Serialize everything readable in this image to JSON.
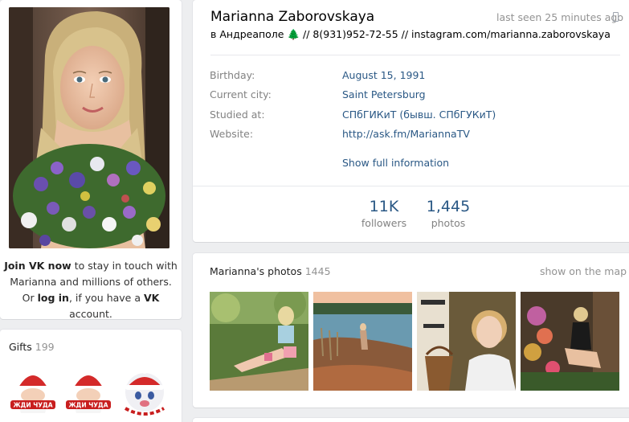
{
  "profile": {
    "name": "Marianna Zaborovskaya",
    "last_seen": "last seen 25 minutes ago",
    "status_prefix": "в Андреаполе",
    "status_tree": "🌲",
    "status_rest": " // 8(931)952-72-55 // instagram.com/marianna.zaborovskaya",
    "info": [
      {
        "label": "Birthday:",
        "value": "August 15, 1991"
      },
      {
        "label": "Current city:",
        "value": "Saint Petersburg"
      },
      {
        "label": "Studied at:",
        "value": "СПбГИКиТ (бывш. СПбГУКиТ)"
      },
      {
        "label": "Website:",
        "value": "http://ask.fm/MariannaTV"
      }
    ],
    "show_full": "Show full information",
    "counters": [
      {
        "num": "11K",
        "label": "followers"
      },
      {
        "num": "1,445",
        "label": "photos"
      }
    ]
  },
  "join": {
    "line1_bold": "Join VK now",
    "line1_rest": " to stay in touch with",
    "line2": "Marianna and millions of others.",
    "line3_a": "Or ",
    "line3_login": "log in",
    "line3_b": ", if you have a ",
    "line3_vk": "VK",
    "line3_c": " account."
  },
  "gifts": {
    "title": "Gifts",
    "count": "199",
    "items": [
      {
        "icon": "santa-gift-icon",
        "text": "ЖДИ ЧУДА"
      },
      {
        "icon": "santa-gift-icon",
        "text": "ЖДИ ЧУДА"
      },
      {
        "icon": "bear-gift-icon",
        "text": ""
      }
    ]
  },
  "photos": {
    "title": "Marianna's photos",
    "count": "1445",
    "show_map": "show on the map"
  },
  "colors": {
    "link": "#2a5885",
    "muted": "#939393",
    "label": "#828282",
    "background": "#edeef0"
  }
}
